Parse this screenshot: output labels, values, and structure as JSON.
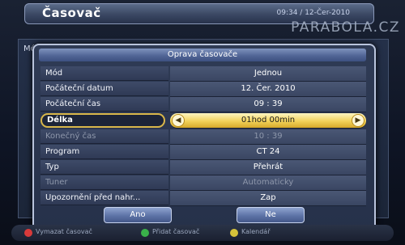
{
  "header": {
    "title": "Časovač",
    "clock": "09:34 / 12-Čer-2010"
  },
  "watermark": "PARABOLA.CZ",
  "background_list": {
    "column_label": "Mó"
  },
  "dialog": {
    "title": "Oprava časovače",
    "rows": [
      {
        "label": "Mód",
        "value": "Jednou"
      },
      {
        "label": "Počáteční datum",
        "value": "12. Čer. 2010"
      },
      {
        "label": "Počáteční čas",
        "value": "09 : 39"
      },
      {
        "label": "Délka",
        "value": "01hod 00min"
      },
      {
        "label": "Konečný čas",
        "value": "10 : 39"
      },
      {
        "label": "Program",
        "value": "CT 24"
      },
      {
        "label": "Typ",
        "value": "Přehrát"
      },
      {
        "label": "Tuner",
        "value": "Automaticky"
      },
      {
        "label": "Upozornění před nahr...",
        "value": "Zap"
      }
    ],
    "buttons": {
      "yes": "Ano",
      "no": "Ne"
    }
  },
  "legend": {
    "items": [
      {
        "color": "red",
        "text": "Vymazat časovač"
      },
      {
        "color": "green",
        "text": "Přidat časovač"
      },
      {
        "color": "yellow",
        "text": "Kalendář"
      }
    ]
  },
  "colors": {
    "selection": "#f2d25a",
    "dialog_bg": "#2f3b55",
    "title_bar": "#4f6394"
  }
}
